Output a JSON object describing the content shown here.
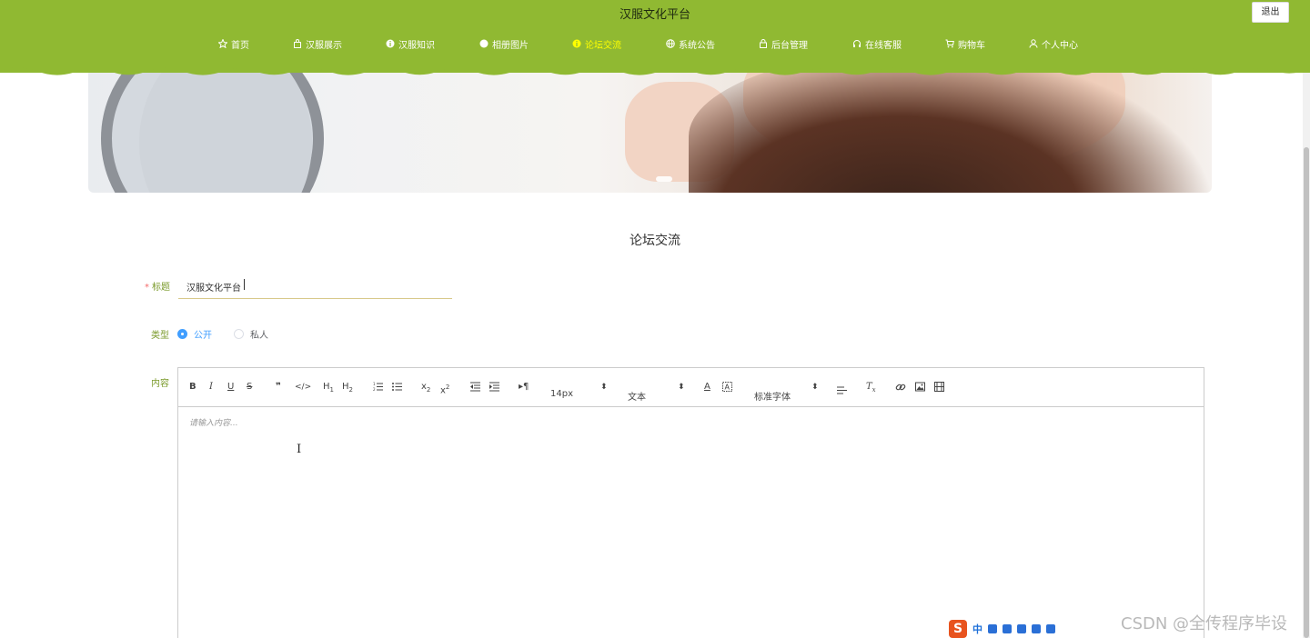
{
  "header": {
    "site_title": "汉服文化平台",
    "logout_label": "退出",
    "nav": [
      {
        "label": "首页",
        "icon": "star-icon"
      },
      {
        "label": "汉服展示",
        "icon": "bag-icon"
      },
      {
        "label": "汉服知识",
        "icon": "info-icon"
      },
      {
        "label": "相册图片",
        "icon": "dot-icon"
      },
      {
        "label": "论坛交流",
        "icon": "info-icon",
        "active": true
      },
      {
        "label": "系统公告",
        "icon": "globe-icon"
      },
      {
        "label": "后台管理",
        "icon": "lock-icon"
      },
      {
        "label": "在线客服",
        "icon": "headset-icon"
      },
      {
        "label": "购物车",
        "icon": "cart-icon"
      },
      {
        "label": "个人中心",
        "icon": "user-icon"
      }
    ],
    "bg_color": "#90b932",
    "active_color": "#ffff00"
  },
  "section_title": "论坛交流",
  "form": {
    "title_label": "标题",
    "title_required_mark": "*",
    "title_value": "汉服文化平台",
    "type_label": "类型",
    "type_options": [
      {
        "label": "公开",
        "selected": true
      },
      {
        "label": "私人",
        "selected": false
      }
    ],
    "content_label": "内容"
  },
  "editor": {
    "font_size": "14px",
    "header_picker": "文本",
    "font_family": "标准字体",
    "placeholder": "请输入内容..."
  },
  "ime": {
    "logo": "S",
    "mode": "中"
  },
  "watermark": "CSDN @全传程序毕设",
  "accent_color": "#409eff"
}
